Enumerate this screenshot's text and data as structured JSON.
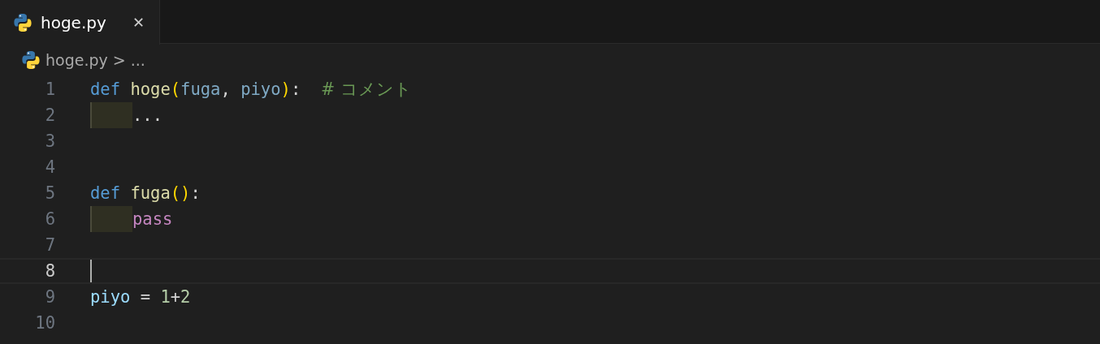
{
  "tabs": [
    {
      "label": "hoge.py",
      "close": "✕",
      "selected": true
    }
  ],
  "breadcrumb": {
    "file": "hoge.py",
    "separator": ">",
    "more": "..."
  },
  "lines": [
    {
      "number": "1",
      "current": false,
      "indent": false,
      "tokens": [
        {
          "kind": "keyword",
          "text": "def "
        },
        {
          "kind": "function",
          "text": "hoge"
        },
        {
          "kind": "bracket",
          "text": "("
        },
        {
          "kind": "parameter",
          "text": "fuga"
        },
        {
          "kind": "plain",
          "text": ", "
        },
        {
          "kind": "parameter",
          "text": "piyo"
        },
        {
          "kind": "bracket",
          "text": ")"
        },
        {
          "kind": "plain",
          "text": ":  "
        },
        {
          "kind": "comment",
          "text": "# コメント"
        }
      ]
    },
    {
      "number": "2",
      "current": false,
      "indent": true,
      "tokens": [
        {
          "kind": "plain",
          "text": "..."
        }
      ]
    },
    {
      "number": "3",
      "current": false,
      "indent": false
    },
    {
      "number": "4",
      "current": false,
      "indent": false
    },
    {
      "number": "5",
      "current": false,
      "indent": false,
      "tokens": [
        {
          "kind": "keyword",
          "text": "def "
        },
        {
          "kind": "function",
          "text": "fuga"
        },
        {
          "kind": "bracket",
          "text": "()"
        },
        {
          "kind": "plain",
          "text": ":"
        }
      ]
    },
    {
      "number": "6",
      "current": false,
      "indent": true,
      "tokens": [
        {
          "kind": "control",
          "text": "pass"
        }
      ]
    },
    {
      "number": "7",
      "current": false,
      "indent": false
    },
    {
      "number": "8",
      "current": true,
      "indent": false
    },
    {
      "number": "9",
      "current": false,
      "indent": false,
      "tokens": [
        {
          "kind": "variable",
          "text": "piyo"
        },
        {
          "kind": "plain",
          "text": " = "
        },
        {
          "kind": "number",
          "text": "1"
        },
        {
          "kind": "plain",
          "text": "+"
        },
        {
          "kind": "number",
          "text": "2"
        }
      ]
    },
    {
      "number": "10",
      "current": false,
      "indent": false
    }
  ]
}
